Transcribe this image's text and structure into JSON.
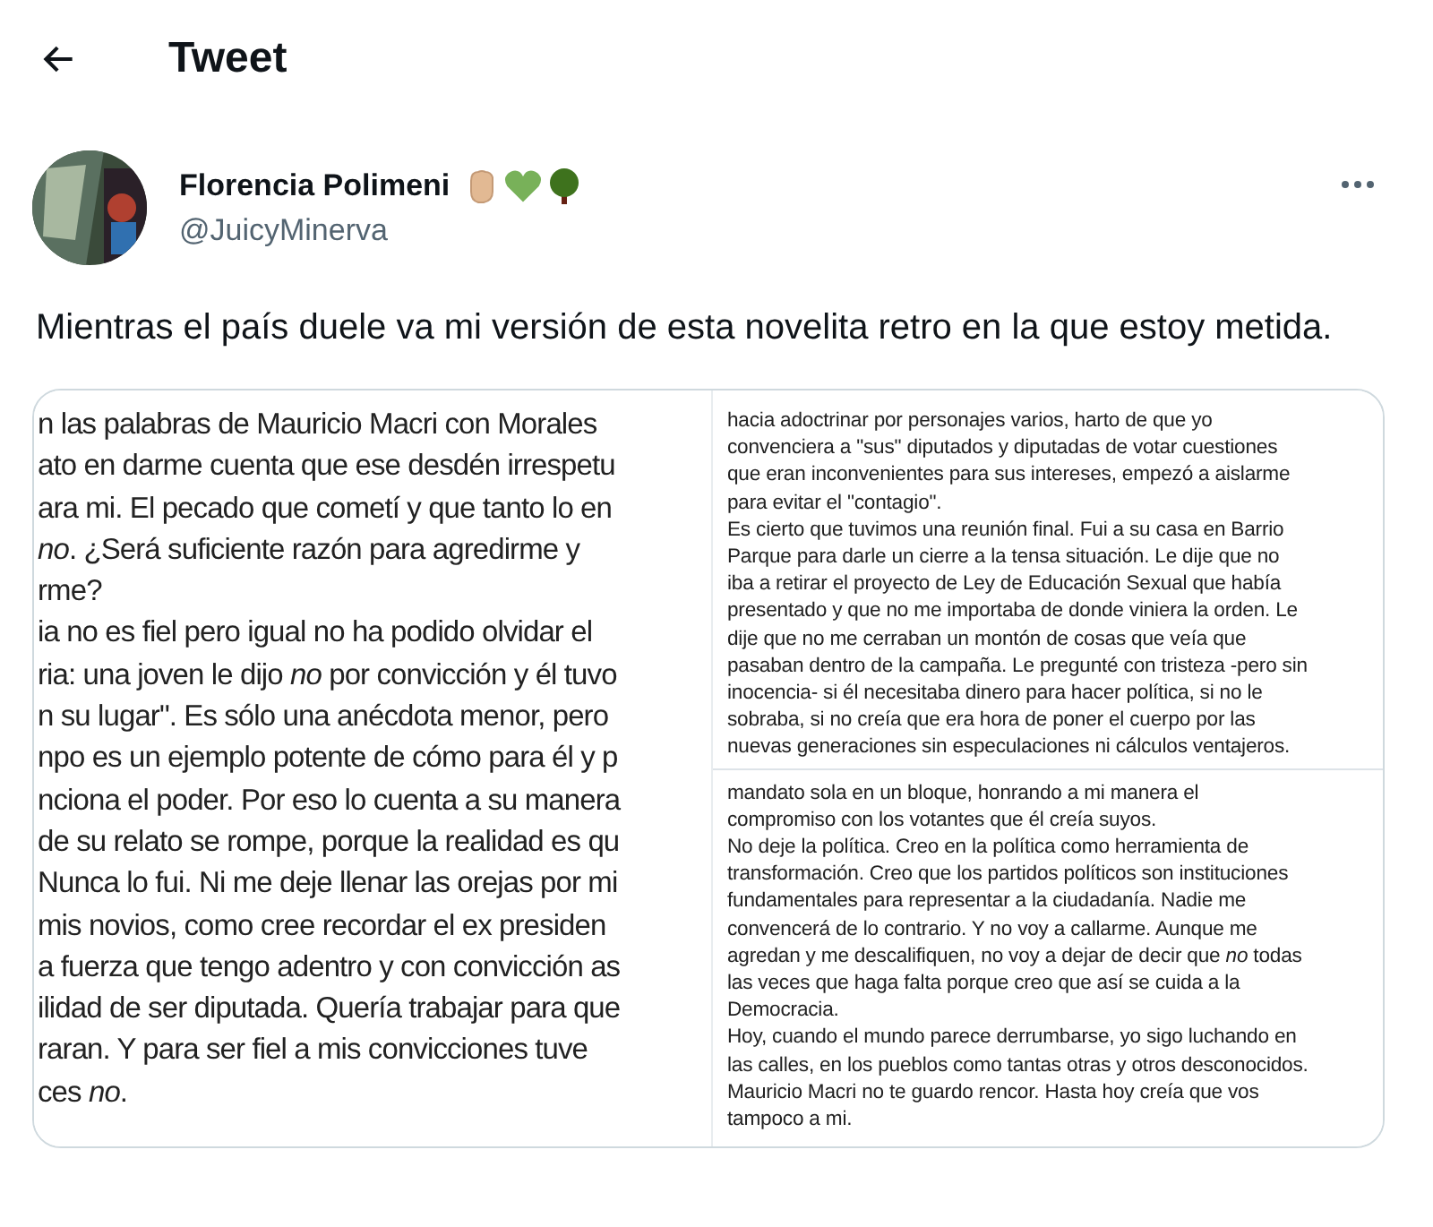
{
  "header": {
    "title": "Tweet"
  },
  "author": {
    "name": "Florencia Polimeni",
    "handle": "@JuicyMinerva"
  },
  "text": "Mientras el país duele va mi versión de esta novelita retro en la que estoy metida.",
  "left_image": {
    "lines": [
      "n las palabras de Mauricio Macri con Morales",
      "ato en darme cuenta que ese desdén irrespetu",
      "ara mi. El pecado que cometí y que tanto lo en",
      "*no*. ¿Será suficiente razón para agredirme y",
      "rme?",
      "ia no es fiel pero igual no ha podido olvidar el",
      "ria: una joven le dijo *no* por convicción y él tuvo",
      "n su lugar\". Es sólo una anécdota menor, pero",
      "npo es un ejemplo potente de cómo para él y p",
      "nciona el poder. Por eso lo cuenta a su manera",
      "de su relato se rompe, porque la realidad es qu",
      "Nunca lo fui. Ni me deje llenar las orejas por mi",
      "mis novios, como cree recordar el ex presiden",
      "a fuerza que tengo adentro y con convicción as",
      "ilidad de ser diputada. Quería trabajar para que",
      "raran. Y para ser fiel a mis convicciones tuve",
      "ces *no*."
    ]
  },
  "right_image": {
    "panels": [
      {
        "lines": [
          "hacia adoctrinar por personajes varios, harto de que yo",
          "convenciera a \"sus\" diputados y diputadas de votar cuestiones",
          "que eran inconvenientes para sus intereses, empezó a aislarme",
          "para evitar el \"contagio\".",
          "Es cierto que tuvimos una reunión final. Fui a su casa en Barrio",
          "Parque para darle un cierre a la tensa situación. Le dije que no",
          "iba a retirar el proyecto de Ley de Educación Sexual que había",
          "presentado y que no me importaba de donde viniera la orden. Le",
          "dije que no me cerraban un montón de cosas que veía que",
          "pasaban dentro de la campaña. Le pregunté con tristeza -pero sin",
          "inocencia- si él necesitaba dinero para hacer política, si no le",
          "sobraba, si no creía que era hora de poner el cuerpo por las",
          "nuevas generaciones sin especulaciones ni cálculos ventajeros."
        ]
      },
      {
        "lines": [
          "mandato sola en un bloque, honrando a mi manera el",
          "compromiso con los votantes que él creía suyos.",
          "No deje la política. Creo en la política como herramienta de",
          "transformación. Creo que los partidos políticos son instituciones",
          "fundamentales para representar a la ciudadanía. Nadie me",
          "convencerá de lo contrario. Y no voy a callarme. Aunque me",
          "agredan y me descalifiquen, no voy a dejar de decir que *no* todas",
          "las veces que haga falta porque creo que así se cuida a la",
          "Democracia.",
          "Hoy, cuando el mundo parece derrumbarse, yo sigo luchando en",
          "las calles, en los pueblos como tantas otras y otros desconocidos.",
          "Mauricio Macri no te guardo rencor. Hasta hoy creía que vos",
          "tampoco a mi."
        ]
      }
    ]
  }
}
